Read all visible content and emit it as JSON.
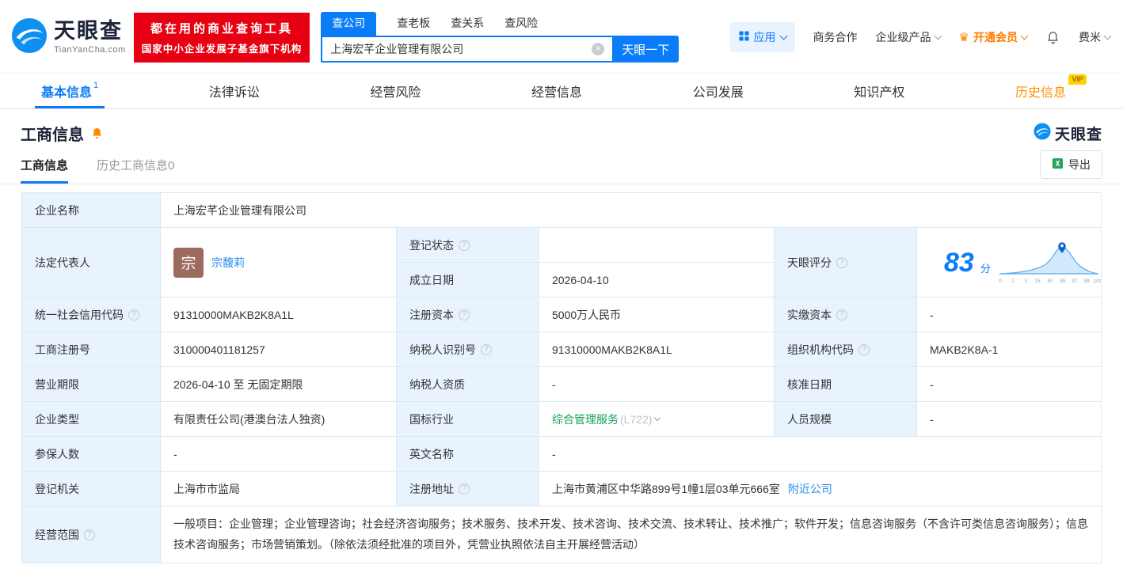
{
  "header": {
    "logo": {
      "brand": "天眼查",
      "domain": "TianYanCha.com"
    },
    "slogan": {
      "line1": "都在用的商业查询工具",
      "line2": "国家中小企业发展子基金旗下机构"
    },
    "search_tabs": [
      {
        "label": "查公司"
      },
      {
        "label": "查老板"
      },
      {
        "label": "查关系"
      },
      {
        "label": "查风险"
      }
    ],
    "search": {
      "value": "上海宏芊企业管理有限公司",
      "button": "天眼一下"
    },
    "nav": {
      "apps": "应用",
      "cooperation": "商务合作",
      "enterprise": "企业级产品",
      "vip": "开通会员",
      "user": "费米"
    }
  },
  "tabs": [
    {
      "label": "基本信息",
      "badge": "1"
    },
    {
      "label": "法律诉讼"
    },
    {
      "label": "经营风险"
    },
    {
      "label": "经营信息"
    },
    {
      "label": "公司发展"
    },
    {
      "label": "知识产权"
    },
    {
      "label": "历史信息",
      "tag": "VIP"
    }
  ],
  "section": {
    "title": "工商信息",
    "watermark": "天眼查",
    "subtabs": [
      {
        "label": "工商信息"
      },
      {
        "label": "历史工商信息0"
      }
    ],
    "export": "导出"
  },
  "info": {
    "company_name": {
      "label": "企业名称",
      "value": "上海宏芊企业管理有限公司"
    },
    "legal_rep": {
      "label": "法定代表人",
      "avatar": "宗",
      "value": "宗馥莉"
    },
    "reg_status": {
      "label": "登记状态",
      "value": ""
    },
    "establish_date": {
      "label": "成立日期",
      "value": "2026-04-10"
    },
    "score": {
      "label": "天眼评分",
      "value": "83",
      "unit": "分",
      "axis": [
        "0",
        "1",
        "3",
        "15",
        "50",
        "85",
        "97",
        "99",
        "100"
      ]
    },
    "credit_code": {
      "label": "统一社会信用代码",
      "value": "91310000MAKB2K8A1L"
    },
    "reg_capital": {
      "label": "注册资本",
      "value": "5000万人民币"
    },
    "paid_capital": {
      "label": "实缴资本",
      "value": "-"
    },
    "reg_number": {
      "label": "工商注册号",
      "value": "310000401181257"
    },
    "taxpayer_id": {
      "label": "纳税人识别号",
      "value": "91310000MAKB2K8A1L"
    },
    "org_code": {
      "label": "组织机构代码",
      "value": "MAKB2K8A-1"
    },
    "business_term": {
      "label": "营业期限",
      "value": "2026-04-10 至 无固定期限"
    },
    "taxpayer_quality": {
      "label": "纳税人资质",
      "value": "-"
    },
    "approval_date": {
      "label": "核准日期",
      "value": "-"
    },
    "company_type": {
      "label": "企业类型",
      "value": "有限责任公司(港澳台法人独资)"
    },
    "industry": {
      "label": "国标行业",
      "value": "综合管理服务",
      "code": "(L722)"
    },
    "staff_size": {
      "label": "人员规模",
      "value": "-"
    },
    "insured_count": {
      "label": "参保人数",
      "value": "-"
    },
    "english_name": {
      "label": "英文名称",
      "value": "-"
    },
    "reg_authority": {
      "label": "登记机关",
      "value": "上海市市监局"
    },
    "reg_address": {
      "label": "注册地址",
      "value": "上海市黄浦区中华路899号1幢1层03单元666室",
      "link": "附近公司"
    },
    "business_scope": {
      "label": "经营范围",
      "value": "一般项目：企业管理；企业管理咨询；社会经济咨询服务；技术服务、技术开发、技术咨询、技术交流、技术转让、技术推广；软件开发；信息咨询服务（不含许可类信息咨询服务）；信息技术咨询服务；市场营销策划。（除依法须经批准的项目外，凭营业执照依法自主开展经营活动）"
    }
  }
}
